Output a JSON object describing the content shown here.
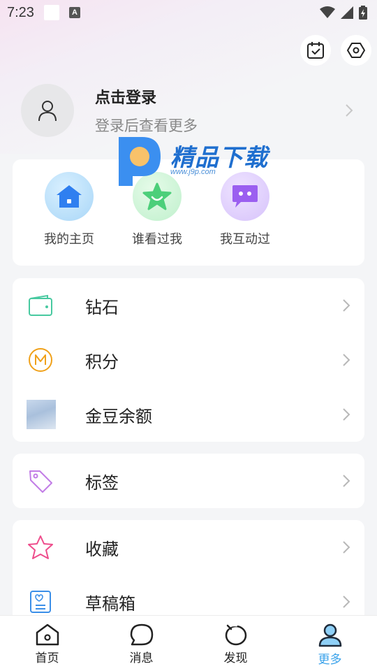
{
  "status_bar": {
    "time": "7:23"
  },
  "profile": {
    "title": "点击登录",
    "subtitle": "登录后查看更多"
  },
  "watermark": {
    "text": "精品下载",
    "url": "www.j9p.com"
  },
  "quick_actions": [
    {
      "label": "我的主页",
      "icon": "home-icon",
      "color": "#2f7ff0"
    },
    {
      "label": "谁看过我",
      "icon": "star-smile-icon",
      "color": "#4ccf7a"
    },
    {
      "label": "我互动过",
      "icon": "chat-bubble-icon",
      "color": "#9b5ff0"
    }
  ],
  "menu_group_1": [
    {
      "label": "钻石",
      "icon": "wallet-icon"
    },
    {
      "label": "积分",
      "icon": "points-coin-icon"
    },
    {
      "label": "金豆余额",
      "icon": "sky-image-icon"
    }
  ],
  "menu_group_2": [
    {
      "label": "标签",
      "icon": "tag-icon"
    }
  ],
  "menu_group_3": [
    {
      "label": "收藏",
      "icon": "star-outline-icon"
    },
    {
      "label": "草稿箱",
      "icon": "draft-box-icon"
    }
  ],
  "tab_bar": [
    {
      "label": "首页",
      "icon": "home-tab-icon"
    },
    {
      "label": "消息",
      "icon": "message-tab-icon"
    },
    {
      "label": "发现",
      "icon": "discover-tab-icon"
    },
    {
      "label": "更多",
      "icon": "profile-tab-icon",
      "active": true
    }
  ],
  "colors": {
    "accent": "#3aa2ea",
    "background": "#f4f5f7",
    "watermark": "#1f6fcf"
  }
}
